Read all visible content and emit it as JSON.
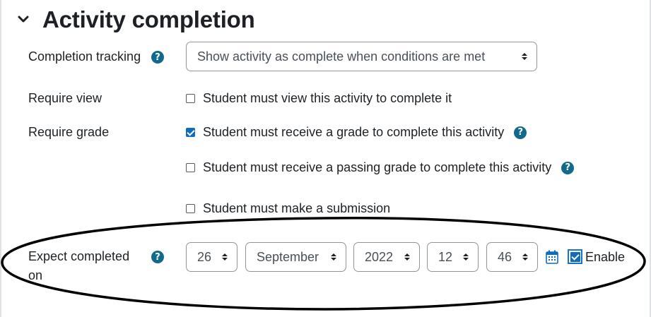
{
  "section": {
    "title": "Activity completion",
    "collapse_icon": "chevron-down-icon"
  },
  "completion_tracking": {
    "label": "Completion tracking",
    "help_icon": "question-circle-icon",
    "value": "Show activity as complete when conditions are met"
  },
  "require_view": {
    "label": "Require view",
    "checkbox_label": "Student must view this activity to complete it",
    "checked": false
  },
  "require_grade": {
    "label": "Require grade",
    "options": [
      {
        "label": "Student must receive a grade to complete this activity",
        "checked": true,
        "help": true
      },
      {
        "label": "Student must receive a passing grade to complete this activity",
        "checked": false,
        "help": true
      },
      {
        "label": "Student must make a submission",
        "checked": false,
        "help": false
      }
    ]
  },
  "expect_completed": {
    "label_line1": "Expect completed",
    "label_line2": "on",
    "help_icon": "question-circle-icon",
    "day": "26",
    "month": "September",
    "year": "2022",
    "hour": "12",
    "minute": "46",
    "calendar_icon": "calendar-icon",
    "enable_label": "Enable",
    "enabled": true
  },
  "colors": {
    "help_icon": "#116a8c",
    "checkbox_checked": "#0f6cbf",
    "annotation_ellipse": "#000000"
  }
}
